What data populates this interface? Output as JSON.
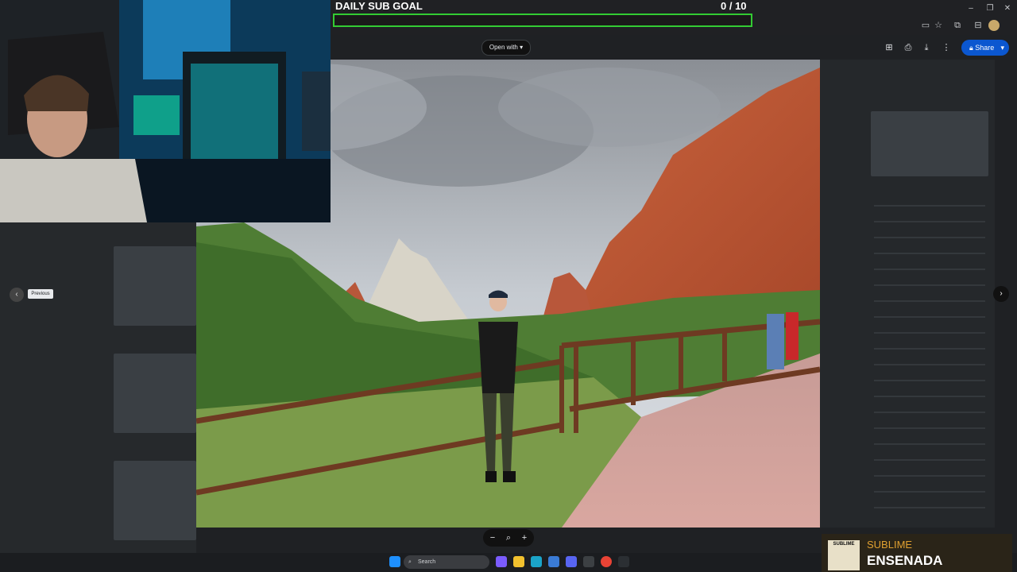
{
  "overlay": {
    "goal_title": "DAILY SUB GOAL",
    "goal_count": "0  / 10",
    "goal_current": 0,
    "goal_target": 10
  },
  "viewer": {
    "open_with_label": "Open with",
    "share_label": "Share",
    "previous_tooltip": "Previous",
    "zoom_out": "−",
    "zoom_in": "+",
    "icons": [
      "comment-add-icon",
      "print-icon",
      "download-icon",
      "more-vert-icon",
      "lock-icon",
      "chevron-down-icon"
    ]
  },
  "taskbar": {
    "search_placeholder": "Search"
  },
  "music": {
    "artist": "SUBLIME",
    "title": "ENSENADA",
    "art_label": "SUBLIME"
  },
  "colors": {
    "goal_border": "#33cc33",
    "share_bg": "#0b57d0",
    "music_accent": "#e0a030"
  }
}
